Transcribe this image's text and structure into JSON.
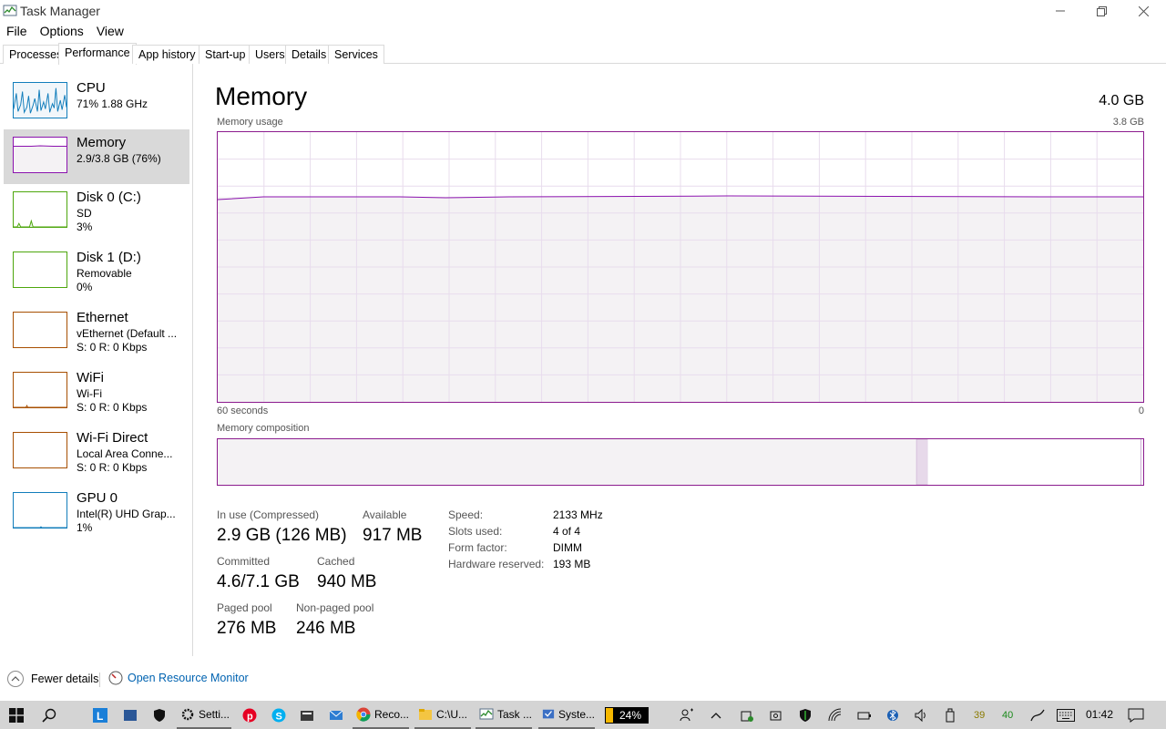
{
  "window": {
    "title": "Task Manager"
  },
  "menu": {
    "file": "File",
    "options": "Options",
    "view": "View"
  },
  "tabs": [
    {
      "label": "Processes"
    },
    {
      "label": "Performance"
    },
    {
      "label": "App history"
    },
    {
      "label": "Start-up"
    },
    {
      "label": "Users"
    },
    {
      "label": "Details"
    },
    {
      "label": "Services"
    }
  ],
  "active_tab": "Performance",
  "sidebar": {
    "items": [
      {
        "name": "CPU",
        "line2": "71% 1.88 GHz",
        "line3": "",
        "color": "#117dbb"
      },
      {
        "name": "Memory",
        "line2": "2.9/3.8 GB (76%)",
        "line3": "",
        "color": "#8b12ae",
        "selected": true
      },
      {
        "name": "Disk 0 (C:)",
        "line2": "SD",
        "line3": "3%",
        "color": "#4da60c"
      },
      {
        "name": "Disk 1 (D:)",
        "line2": "Removable",
        "line3": "0%",
        "color": "#4da60c"
      },
      {
        "name": "Ethernet",
        "line2": "vEthernet (Default ...",
        "line3": "S: 0 R: 0 Kbps",
        "color": "#a74f01"
      },
      {
        "name": "WiFi",
        "line2": "Wi-Fi",
        "line3": "S: 0 R: 0 Kbps",
        "color": "#a74f01"
      },
      {
        "name": "Wi-Fi Direct",
        "line2": "Local Area Conne...",
        "line3": "S: 0 R: 0 Kbps",
        "color": "#a74f01"
      },
      {
        "name": "GPU 0",
        "line2": "Intel(R) UHD Grap...",
        "line3": "1%",
        "color": "#117dbb"
      }
    ]
  },
  "memory": {
    "heading": "Memory",
    "total": "4.0 GB",
    "usage_label": "Memory usage",
    "usage_max": "3.8 GB",
    "time_label": "60 seconds",
    "time_end": "0",
    "composition_label": "Memory composition",
    "usage_level": 0.76,
    "composition": {
      "in_use": 0.755,
      "modified": 0.012,
      "standby": 0.23,
      "free": 0.003
    },
    "stats": {
      "in_use_label": "In use (Compressed)",
      "in_use_value": "2.9 GB (126 MB)",
      "available_label": "Available",
      "available_value": "917 MB",
      "committed_label": "Committed",
      "committed_value": "4.6/7.1 GB",
      "cached_label": "Cached",
      "cached_value": "940 MB",
      "paged_label": "Paged pool",
      "paged_value": "276 MB",
      "nonpaged_label": "Non-paged pool",
      "nonpaged_value": "246 MB"
    },
    "specs": {
      "speed_label": "Speed:",
      "speed_value": "2133 MHz",
      "slots_label": "Slots used:",
      "slots_value": "4 of 4",
      "form_label": "Form factor:",
      "form_value": "DIMM",
      "reserved_label": "Hardware reserved:",
      "reserved_value": "193 MB"
    }
  },
  "footer": {
    "fewer_details": "Fewer details",
    "open_resmon": "Open Resource Monitor"
  },
  "taskbar": {
    "apps": [
      {
        "label": "Setti..."
      },
      {
        "label": "Reco..."
      },
      {
        "label": "C:\\U..."
      },
      {
        "label": "Task ..."
      },
      {
        "label": "Syste..."
      }
    ],
    "battery": "24%",
    "tray_num1": "39",
    "tray_num2": "40",
    "clock": "01:42"
  }
}
